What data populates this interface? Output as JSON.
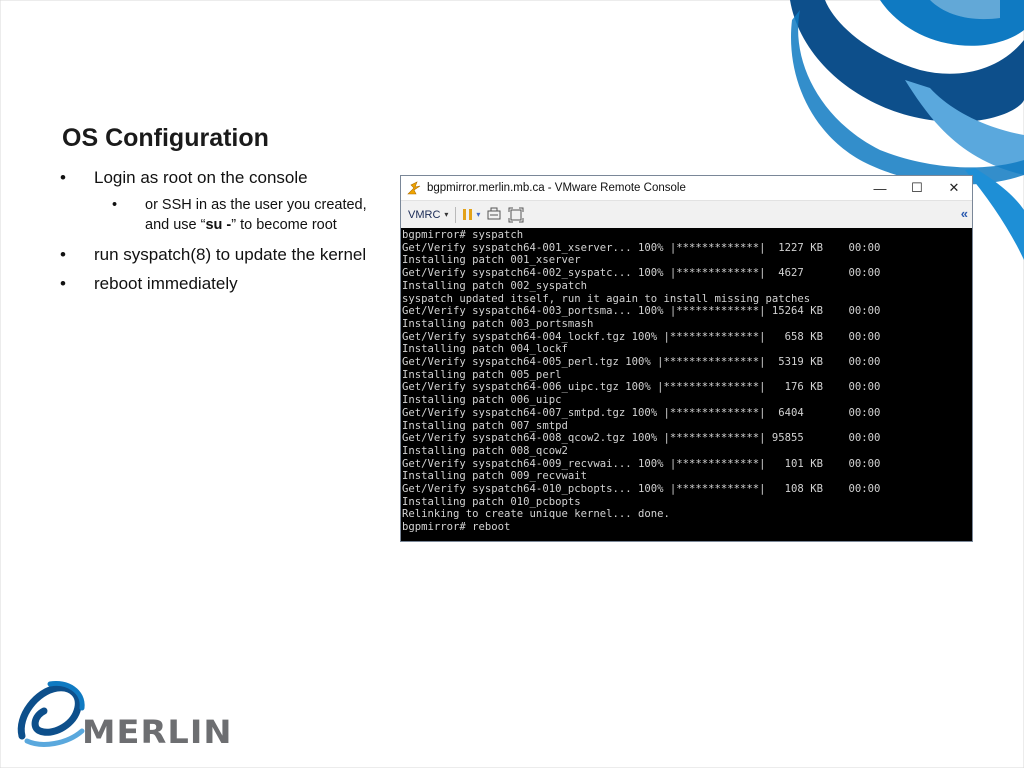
{
  "slide": {
    "title": "OS Configuration",
    "bullets": [
      {
        "text": "Login as root on the console"
      },
      {
        "pre": "or SSH in as the user you created, and use “",
        "bold": "su -",
        "post": "” to become root"
      },
      {
        "text": "run syspatch(8) to update the kernel"
      },
      {
        "text": "reboot immediately"
      }
    ],
    "bullet_glyph": "•"
  },
  "window": {
    "title": "bgpmirror.merlin.mb.ca - VMware Remote Console",
    "controls": {
      "minimize": "—",
      "maximize": "☐",
      "close": "✕"
    },
    "toolbar": {
      "menu_label": "VMRC",
      "menu_caret": "▾",
      "collapse": "«"
    },
    "icons": {
      "app": "vmrc-app-icon",
      "pause": "pause-icon",
      "send-keys": "send-ctrl-alt-del-icon",
      "fullscreen": "fullscreen-icon"
    },
    "terminal_lines": [
      "bgpmirror# syspatch",
      "Get/Verify syspatch64-001_xserver... 100% |*************|  1227 KB    00:00",
      "Installing patch 001_xserver",
      "Get/Verify syspatch64-002_syspatc... 100% |*************|  4627       00:00",
      "Installing patch 002_syspatch",
      "syspatch updated itself, run it again to install missing patches",
      "Get/Verify syspatch64-003_portsma... 100% |*************| 15264 KB    00:00",
      "Installing patch 003_portsmash",
      "Get/Verify syspatch64-004_lockf.tgz 100% |**************|   658 KB    00:00",
      "Installing patch 004_lockf",
      "Get/Verify syspatch64-005_perl.tgz 100% |***************|  5319 KB    00:00",
      "Installing patch 005_perl",
      "Get/Verify syspatch64-006_uipc.tgz 100% |***************|   176 KB    00:00",
      "Installing patch 006_uipc",
      "Get/Verify syspatch64-007_smtpd.tgz 100% |**************|  6404       00:00",
      "Installing patch 007_smtpd",
      "Get/Verify syspatch64-008_qcow2.tgz 100% |**************| 95855       00:00",
      "Installing patch 008_qcow2",
      "Get/Verify syspatch64-009_recvwai... 100% |*************|   101 KB    00:00",
      "Installing patch 009_recvwait",
      "Get/Verify syspatch64-010_pcbopts... 100% |*************|   108 KB    00:00",
      "Installing patch 010_pcbopts",
      "Relinking to create unique kernel... done.",
      "bgpmirror# reboot"
    ]
  },
  "logo": {
    "text": "MERLIN",
    "icon": "merlin-swirl-logo"
  },
  "colors": {
    "accent_blue": "#0f7ac2",
    "dark_blue": "#0d4f8b",
    "light_blue": "#5aa8dd",
    "logo_gray": "#6d6e71",
    "terminal_text": "#d2d2d2"
  }
}
